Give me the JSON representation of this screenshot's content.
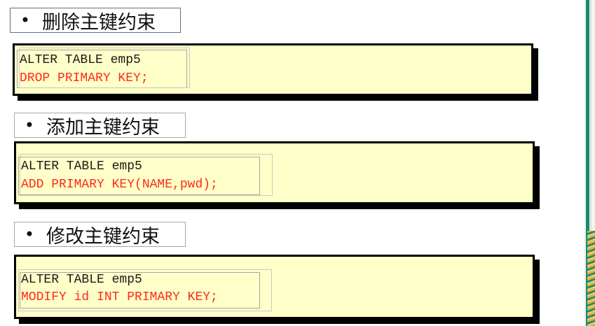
{
  "sections": [
    {
      "heading": "删除主键约束",
      "bullet": "•",
      "code": [
        "ALTER TABLE emp5",
        "DROP PRIMARY KEY;"
      ]
    },
    {
      "heading": "添加主键约束",
      "bullet": "•",
      "code": [
        "ALTER TABLE emp5",
        "ADD PRIMARY KEY(NAME,pwd);"
      ]
    },
    {
      "heading": "修改主键约束",
      "bullet": "•",
      "code": [
        "ALTER TABLE emp5",
        "MODIFY id INT PRIMARY KEY;"
      ]
    }
  ],
  "colors": {
    "code_background": "#ffffc9",
    "code_dark": "#1a1a1a",
    "code_red": "#ff2a1a",
    "accent_bar": "#0e8d76"
  }
}
